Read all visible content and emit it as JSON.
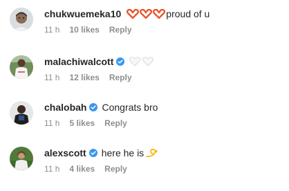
{
  "comments": [
    {
      "username": "chukwuemeka10",
      "verified": false,
      "avatar_icon": "child-portrait-avatar",
      "text": "proud of u",
      "emoji_prefix": [
        "heart-hands-icon",
        "heart-hands-icon",
        "heart-hands-icon"
      ],
      "time": "11 h",
      "likes": "10 likes",
      "reply": "Reply"
    },
    {
      "username": "malachiwalcott",
      "verified": true,
      "avatar_icon": "man-in-white-kit-avatar",
      "text": "",
      "emoji_prefix": [
        "white-heart-icon",
        "white-heart-icon"
      ],
      "time": "11 h",
      "likes": "12 likes",
      "reply": "Reply"
    },
    {
      "username": "chalobah",
      "verified": true,
      "avatar_icon": "man-in-dark-jacket-avatar",
      "text": "Congrats bro",
      "time": "11 h",
      "likes": "5 likes",
      "reply": "Reply"
    },
    {
      "username": "alexscott",
      "verified": true,
      "avatar_icon": "woman-outdoors-avatar",
      "text": "here he is",
      "emoji_suffix": [
        "dizzy-icon"
      ],
      "time": "11 h",
      "likes": "4 likes",
      "reply": "Reply"
    }
  ],
  "colors": {
    "verified_badge": "#3897f0",
    "heart_hands": "#e8552c",
    "muted_text": "#8e8e8e",
    "primary_text": "#262626"
  }
}
